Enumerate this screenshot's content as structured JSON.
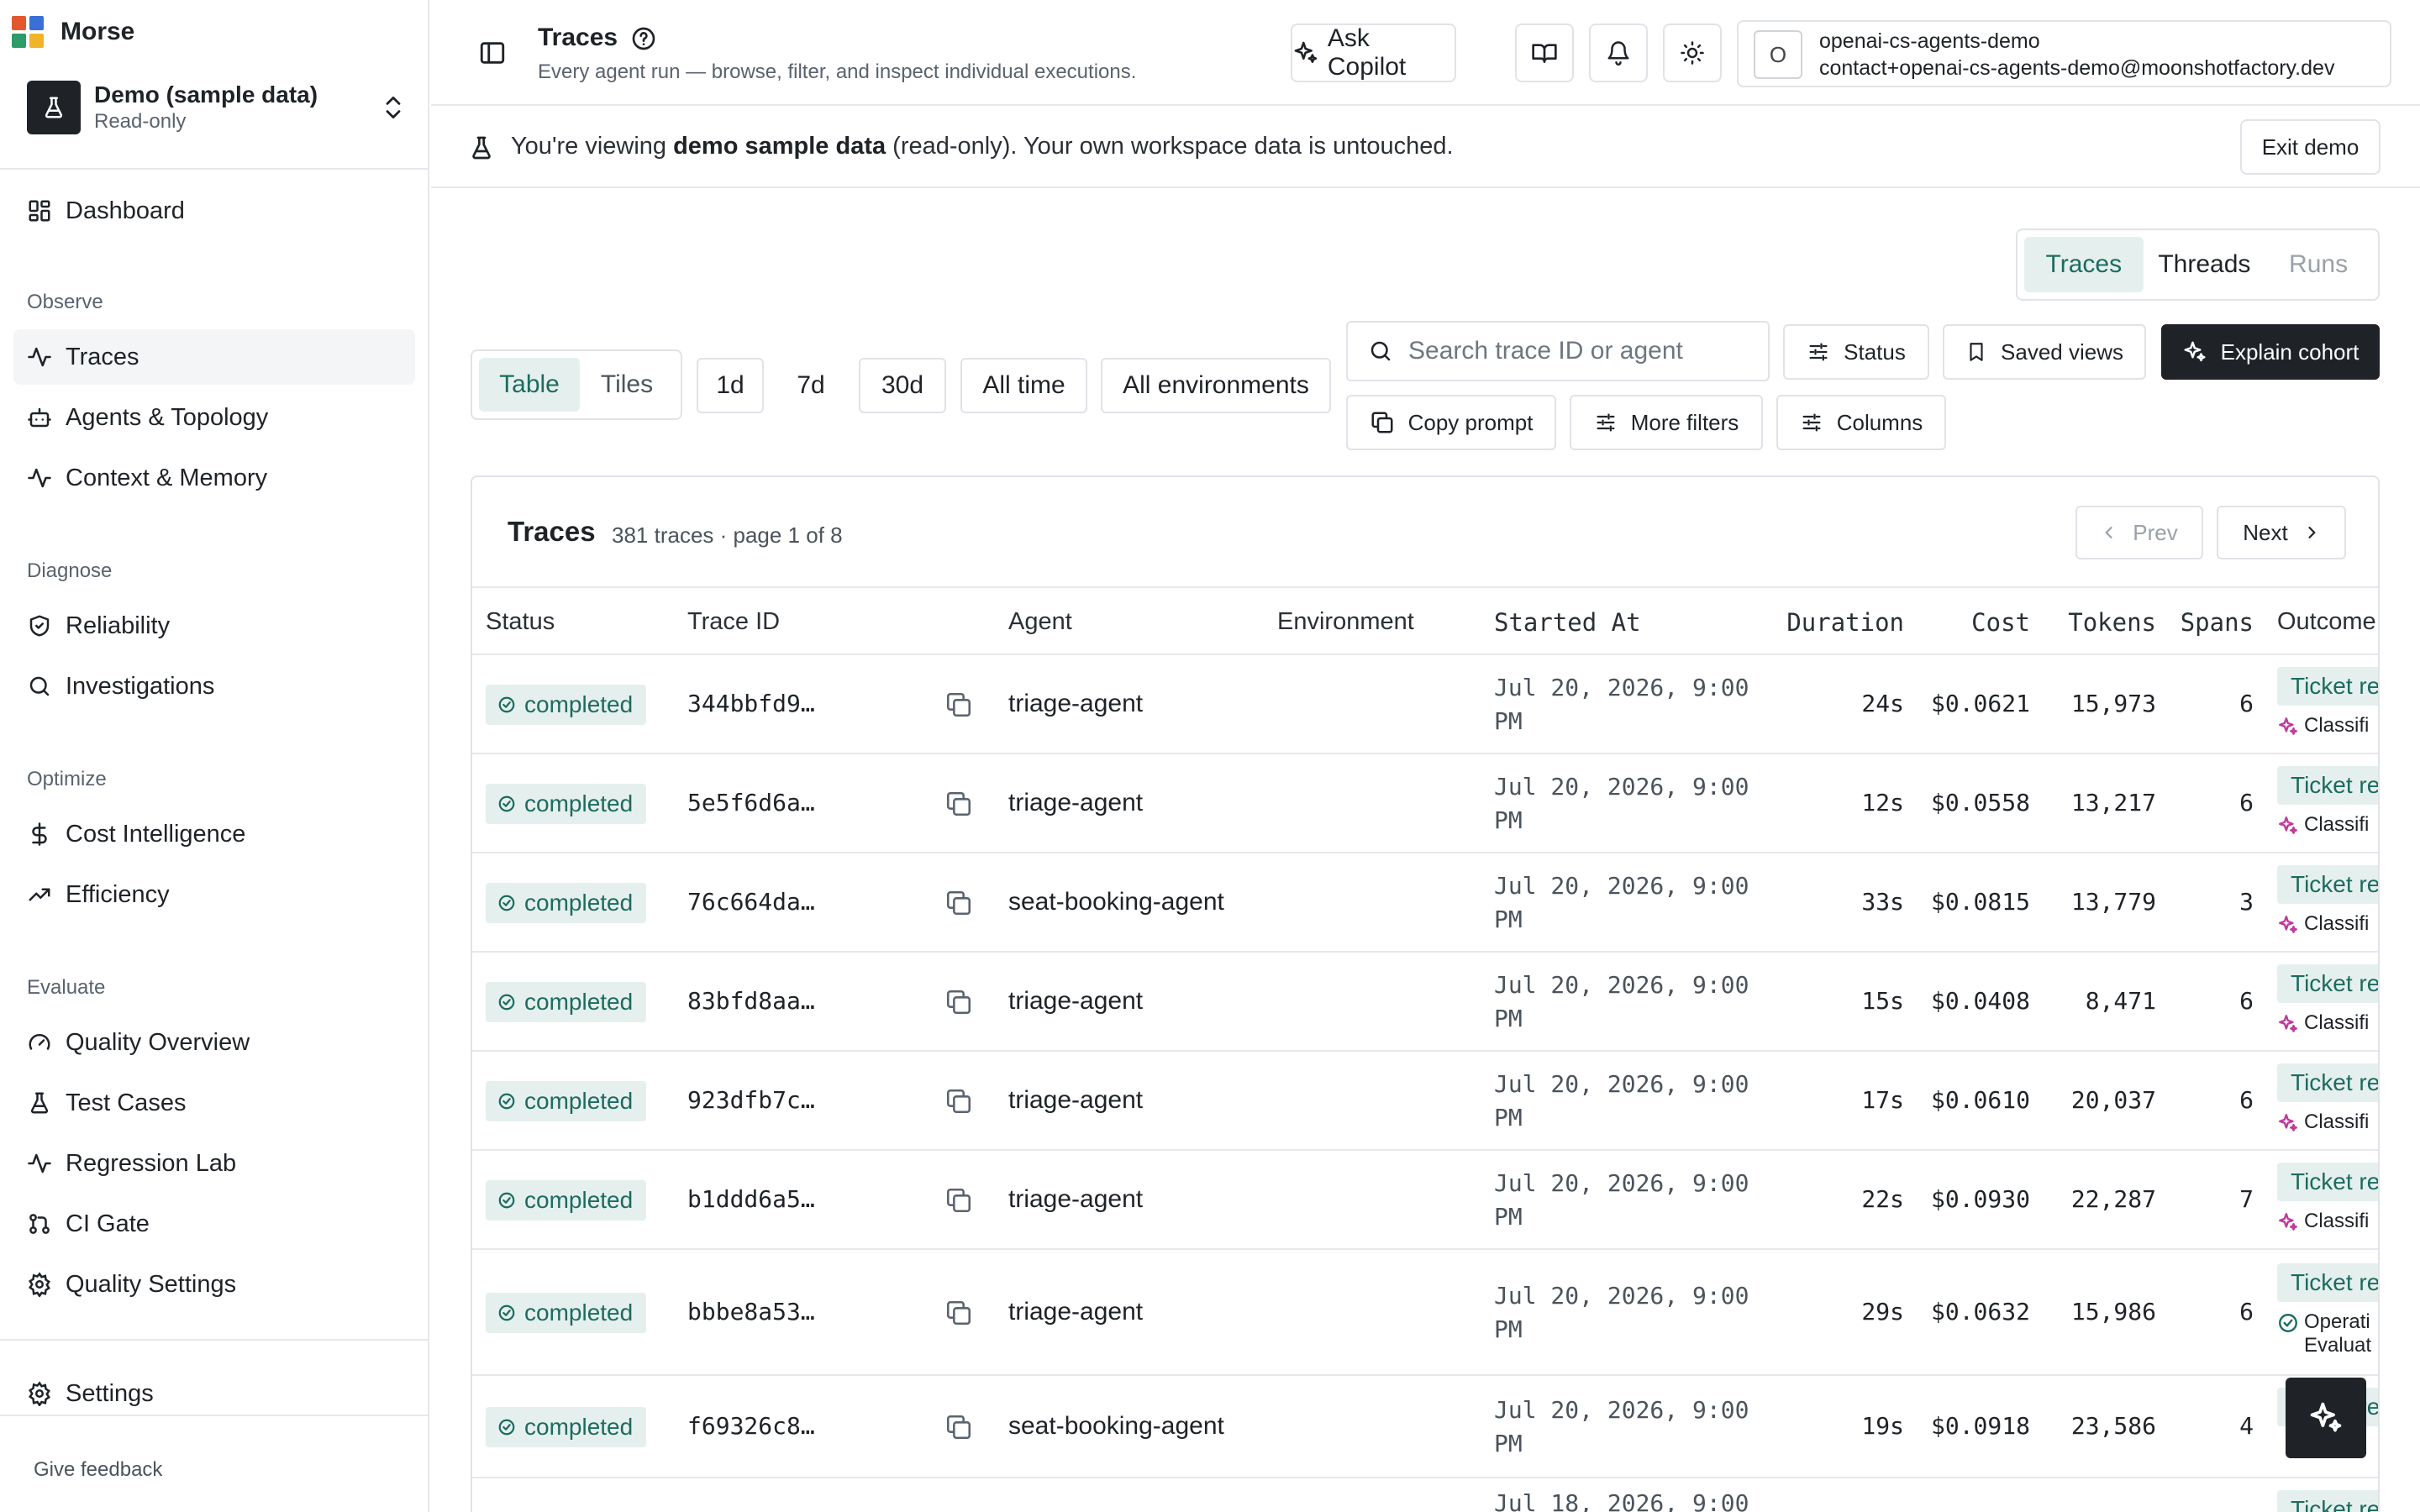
{
  "app": {
    "name": "Morse"
  },
  "workspace": {
    "title": "Demo (sample data)",
    "subtitle": "Read-only"
  },
  "nav": {
    "dashboard": "Dashboard",
    "groups": {
      "observe": "Observe",
      "diagnose": "Diagnose",
      "optimize": "Optimize",
      "evaluate": "Evaluate"
    },
    "traces": "Traces",
    "agents_topology": "Agents & Topology",
    "context_memory": "Context & Memory",
    "reliability": "Reliability",
    "investigations": "Investigations",
    "cost_intelligence": "Cost Intelligence",
    "efficiency": "Efficiency",
    "quality_overview": "Quality Overview",
    "test_cases": "Test Cases",
    "regression_lab": "Regression Lab",
    "ci_gate": "CI Gate",
    "quality_settings": "Quality Settings",
    "settings": "Settings",
    "give_feedback": "Give feedback"
  },
  "header": {
    "title": "Traces",
    "subtitle": "Every agent run — browse, filter, and inspect individual executions.",
    "ask_copilot": "Ask Copilot",
    "account": {
      "initial": "O",
      "name": "openai-cs-agents-demo",
      "email": "contact+openai-cs-agents-demo@moonshotfactory.dev"
    }
  },
  "banner": {
    "prefix": "You're viewing ",
    "bold": "demo sample data",
    "suffix": " (read-only). Your own workspace data is untouched.",
    "exit_label": "Exit demo"
  },
  "view_switch": {
    "traces": "Traces",
    "threads": "Threads",
    "runs": "Runs",
    "selected": "Traces"
  },
  "toolbar": {
    "table": "Table",
    "tiles": "Tiles",
    "ranges": [
      "1d",
      "7d",
      "30d",
      "All time"
    ],
    "selected_range": "7d",
    "environments": "All environments",
    "search_placeholder": "Search trace ID or agent",
    "status": "Status",
    "saved_views": "Saved views",
    "explain_cohort": "Explain cohort",
    "copy_prompt": "Copy prompt",
    "more_filters": "More filters",
    "columns": "Columns"
  },
  "traces_card": {
    "title": "Traces",
    "count": "381 traces · page 1 of 8",
    "prev": "Prev",
    "next": "Next",
    "columns": [
      "Status",
      "Trace ID",
      "Agent",
      "Environment",
      "Started At",
      "Duration",
      "Cost",
      "Tokens",
      "Spans",
      "Outcome"
    ],
    "rows": [
      {
        "status": "completed",
        "trace_id": "344bbfd9…",
        "agent": "triage-agent",
        "environment": "",
        "started_1": "Jul 20, 2026, 9:00",
        "started_2": "PM",
        "duration": "24s",
        "cost": "$0.0621",
        "tokens": "15,973",
        "spans": "6",
        "outcome": "Ticket re",
        "outcome_sub": "Classifi",
        "outcome_sub2": "",
        "outcome_icon": "sparkle-icon"
      },
      {
        "status": "completed",
        "trace_id": "5e5f6d6a…",
        "agent": "triage-agent",
        "environment": "",
        "started_1": "Jul 20, 2026, 9:00",
        "started_2": "PM",
        "duration": "12s",
        "cost": "$0.0558",
        "tokens": "13,217",
        "spans": "6",
        "outcome": "Ticket re",
        "outcome_sub": "Classifi",
        "outcome_sub2": "",
        "outcome_icon": "sparkle-icon"
      },
      {
        "status": "completed",
        "trace_id": "76c664da…",
        "agent": "seat-booking-agent",
        "environment": "",
        "started_1": "Jul 20, 2026, 9:00",
        "started_2": "PM",
        "duration": "33s",
        "cost": "$0.0815",
        "tokens": "13,779",
        "spans": "3",
        "outcome": "Ticket re",
        "outcome_sub": "Classifi",
        "outcome_sub2": "",
        "outcome_icon": "sparkle-icon"
      },
      {
        "status": "completed",
        "trace_id": "83bfd8aa…",
        "agent": "triage-agent",
        "environment": "",
        "started_1": "Jul 20, 2026, 9:00",
        "started_2": "PM",
        "duration": "15s",
        "cost": "$0.0408",
        "tokens": "8,471",
        "spans": "6",
        "outcome": "Ticket re",
        "outcome_sub": "Classifi",
        "outcome_sub2": "",
        "outcome_icon": "sparkle-icon"
      },
      {
        "status": "completed",
        "trace_id": "923dfb7c…",
        "agent": "triage-agent",
        "environment": "",
        "started_1": "Jul 20, 2026, 9:00",
        "started_2": "PM",
        "duration": "17s",
        "cost": "$0.0610",
        "tokens": "20,037",
        "spans": "6",
        "outcome": "Ticket re",
        "outcome_sub": "Classifi",
        "outcome_sub2": "",
        "outcome_icon": "sparkle-icon"
      },
      {
        "status": "completed",
        "trace_id": "b1ddd6a5…",
        "agent": "triage-agent",
        "environment": "",
        "started_1": "Jul 20, 2026, 9:00",
        "started_2": "PM",
        "duration": "22s",
        "cost": "$0.0930",
        "tokens": "22,287",
        "spans": "7",
        "outcome": "Ticket re",
        "outcome_sub": "Classifi",
        "outcome_sub2": "",
        "outcome_icon": "sparkle-icon"
      },
      {
        "status": "completed",
        "trace_id": "bbbe8a53…",
        "agent": "triage-agent",
        "environment": "",
        "started_1": "Jul 20, 2026, 9:00",
        "started_2": "PM",
        "duration": "29s",
        "cost": "$0.0632",
        "tokens": "15,986",
        "spans": "6",
        "outcome": "Ticket re",
        "outcome_sub": "Operati",
        "outcome_sub2": "Evaluat",
        "outcome_icon": "check-circle-icon"
      },
      {
        "status": "completed",
        "trace_id": "f69326c8…",
        "agent": "seat-booking-agent",
        "environment": "",
        "started_1": "Jul 20, 2026, 9:00",
        "started_2": "PM",
        "duration": "19s",
        "cost": "$0.0918",
        "tokens": "23,586",
        "spans": "4",
        "outcome": "Ticket re",
        "outcome_sub": "",
        "outcome_sub2": "",
        "outcome_icon": "sparkle-icon"
      },
      {
        "status": "",
        "trace_id": "",
        "agent": "",
        "environment": "",
        "started_1": "Jul 18, 2026, 9:00",
        "started_2": "",
        "duration": "",
        "cost": "",
        "tokens": "",
        "spans": "",
        "outcome": "Ticket re",
        "outcome_sub": "",
        "outcome_sub2": "",
        "outcome_icon": ""
      }
    ]
  },
  "colors": {
    "accent": "#1d6b5f",
    "accent_bg": "#e5f0ee",
    "sparkle": "#c0399a",
    "dark": "#1f2328",
    "border": "#e0e3e7"
  }
}
